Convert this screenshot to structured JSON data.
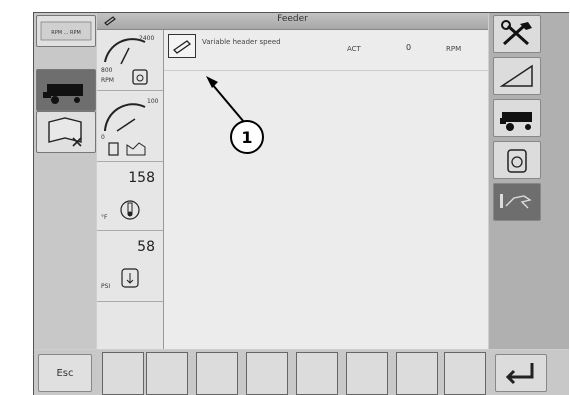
{
  "header": {
    "title": "Feeder"
  },
  "left_panel": {
    "top_button_label": "RPM ... RPM"
  },
  "gauges": [
    {
      "id": "engine-rpm",
      "max_label": "2400",
      "min_label": "800",
      "unit": "RPM"
    },
    {
      "id": "fuel-def-level",
      "max_label": "100",
      "min_label": "0"
    },
    {
      "id": "coolant-temp",
      "value": "158",
      "unit": "°F"
    },
    {
      "id": "oil-pressure",
      "value": "58",
      "unit": "PSI"
    }
  ],
  "main": {
    "row": {
      "label": "Variable header speed",
      "state": "ACT",
      "value": "0",
      "unit": "RPM"
    }
  },
  "callout": {
    "number": "1"
  },
  "bottom": {
    "esc_label": "Esc"
  }
}
